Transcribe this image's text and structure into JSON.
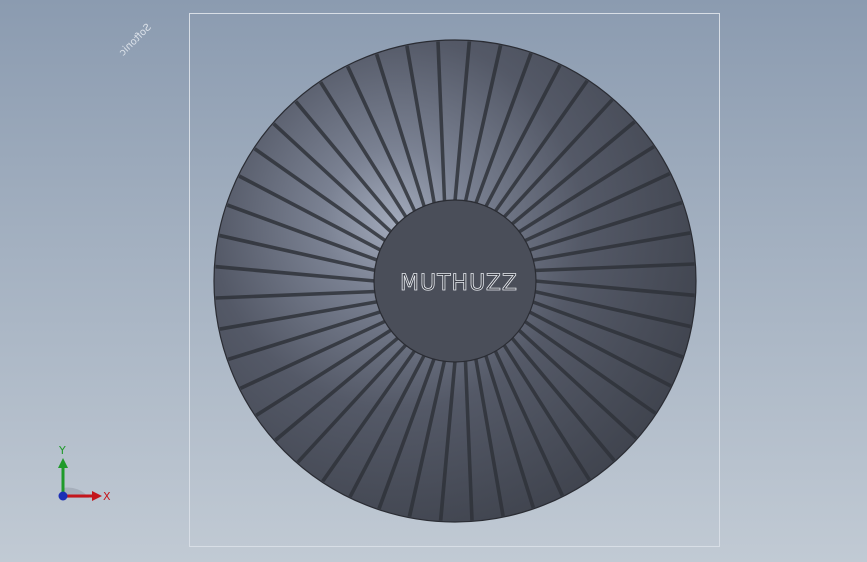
{
  "watermark": {
    "text": "Softonic"
  },
  "model": {
    "name": "fan-impeller",
    "engraving": "MUTHUZZ",
    "blade_count": 48,
    "colors": {
      "face": "#4b4f5b",
      "hub": "#4a4e59",
      "slot": "#2f323a",
      "highlight": "#9aa2b4",
      "edge": "#2a2c33"
    }
  },
  "triad": {
    "x_label": "X",
    "y_label": "Y",
    "colors": {
      "x": "#c4161c",
      "y": "#1f9a2a",
      "z": "#1c2fb5"
    }
  }
}
